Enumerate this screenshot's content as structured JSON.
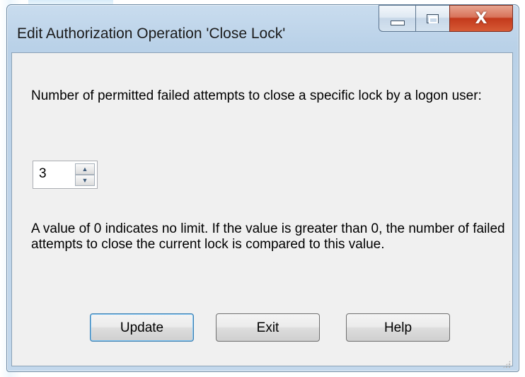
{
  "window": {
    "title": "Edit Authorization Operation 'Close Lock'",
    "close_symbol": "X",
    "minimize_icon": "minimize-icon",
    "maximize_icon": "maximize-icon",
    "close_icon": "close-icon"
  },
  "dialog": {
    "prompt": "Number of permitted failed attempts to close a specific lock by a logon user:",
    "attempts_value": "3",
    "spin_up_icon": "spin-up-arrow-icon",
    "spin_down_icon": "spin-down-arrow-icon",
    "note": "A value of 0 indicates no limit. If the value is greater than 0, the number of failed attempts to close the current lock is compared to this value."
  },
  "buttons": {
    "update": "Update",
    "exit": "Exit",
    "help": "Help"
  },
  "colors": {
    "frame": "#b9d1e8",
    "client": "#f0f0f0",
    "close_button": "#c3391c",
    "default_button_border": "#3c7fb1"
  }
}
